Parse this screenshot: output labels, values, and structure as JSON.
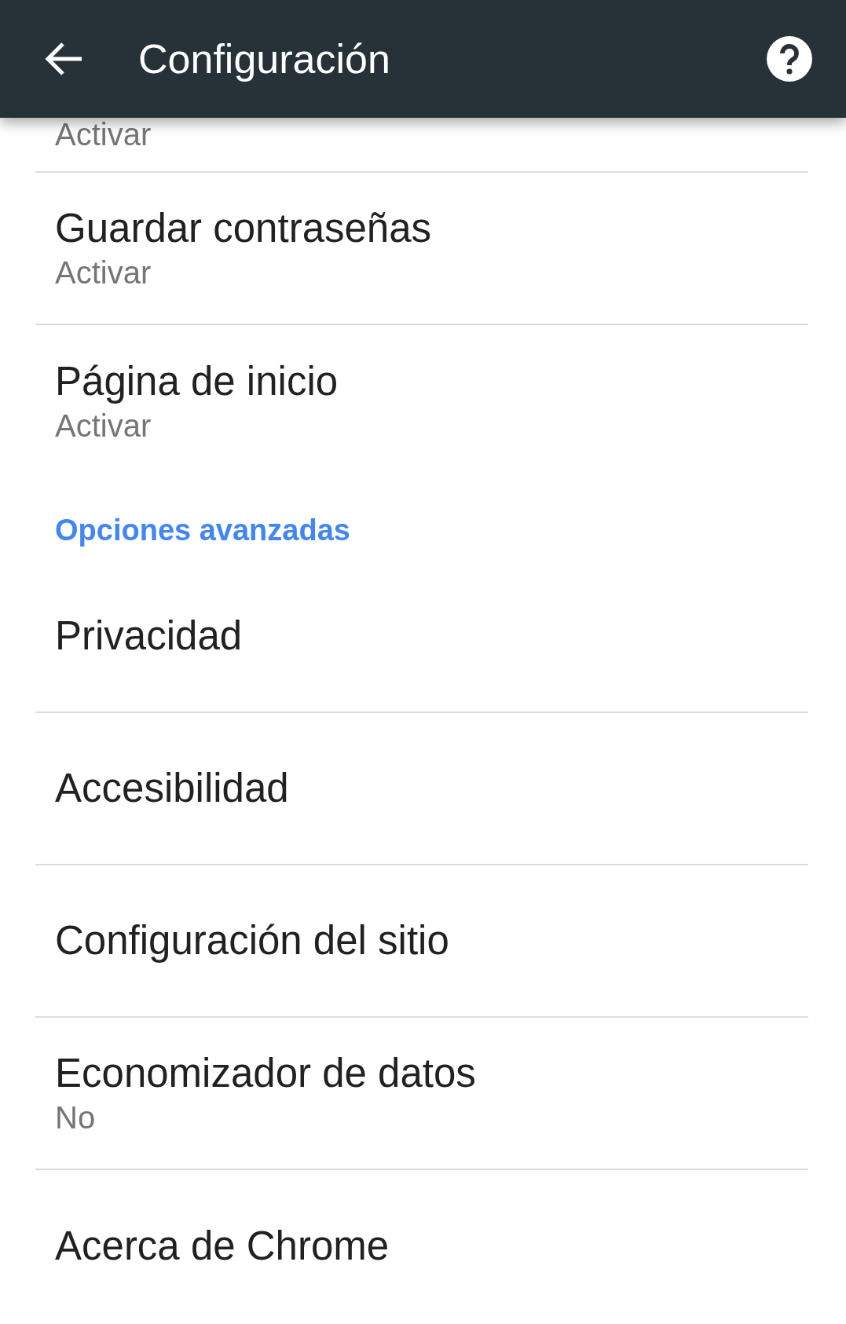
{
  "toolbar": {
    "title": "Configuración"
  },
  "items": [
    {
      "kind": "row",
      "subtitle": "Activar"
    },
    {
      "kind": "row",
      "title": "Guardar contraseñas",
      "subtitle": "Activar"
    },
    {
      "kind": "row",
      "title": "Página de inicio",
      "subtitle": "Activar"
    },
    {
      "kind": "section",
      "label": "Opciones avanzadas"
    },
    {
      "kind": "row",
      "title": "Privacidad"
    },
    {
      "kind": "row",
      "title": "Accesibilidad"
    },
    {
      "kind": "row",
      "title": "Configuración del sitio"
    },
    {
      "kind": "row",
      "title": "Economizador de datos",
      "subtitle": "No"
    },
    {
      "kind": "row",
      "title": "Acerca de Chrome"
    }
  ]
}
